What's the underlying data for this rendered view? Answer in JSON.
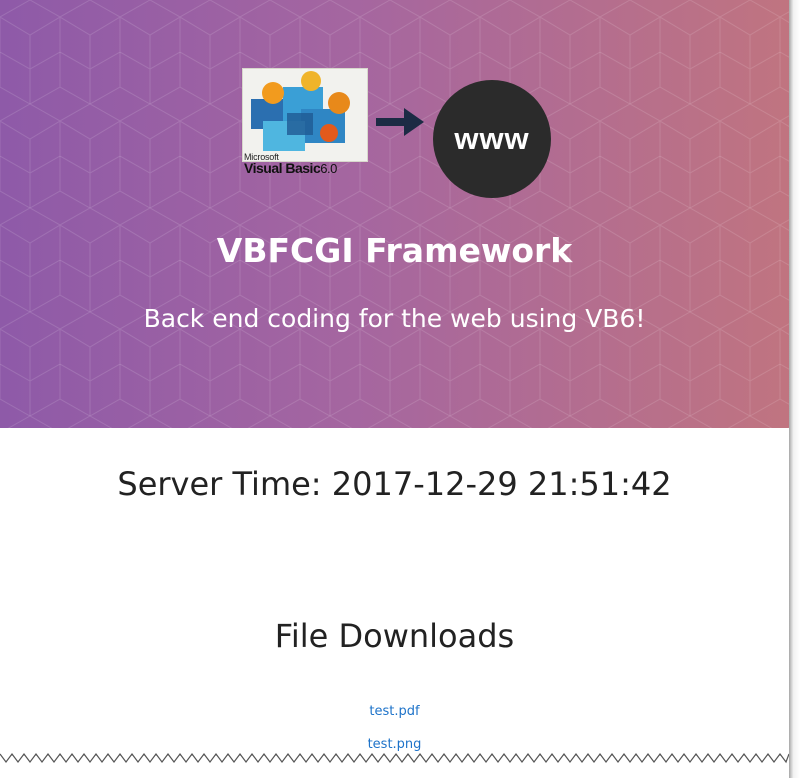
{
  "hero": {
    "logos": {
      "vb_small": "Microsoft",
      "vb_main": "Visual Basic",
      "vb_version": "6.0",
      "www_label": "www"
    },
    "title": "VBFCGI Framework",
    "subtitle": "Back end coding for the web using VB6!",
    "gradient": [
      "#8e5aa8",
      "#c07480"
    ]
  },
  "main": {
    "server_time": "Server Time: 2017-12-29 21:51:42",
    "downloads_heading": "File Downloads",
    "downloads": [
      {
        "label": "test.pdf"
      },
      {
        "label": "test.png"
      }
    ],
    "link_color": "#1e73c9"
  }
}
